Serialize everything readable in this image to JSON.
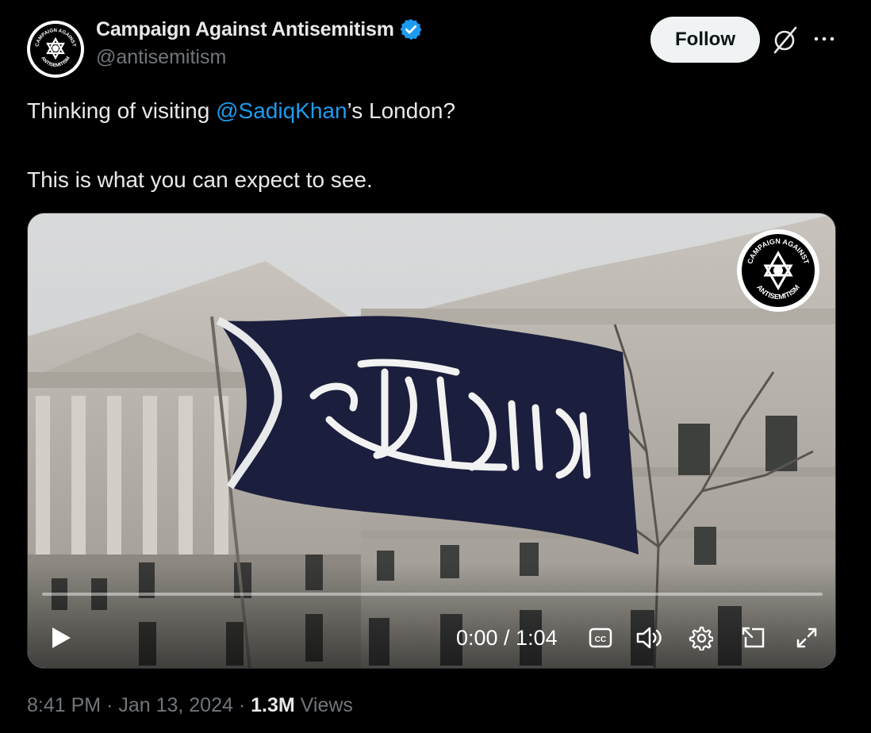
{
  "author": {
    "display_name": "Campaign Against Antisemitism",
    "handle": "@antisemitism",
    "avatar_text_top": "CAMPAIGN AGAINST",
    "avatar_text_bottom": "ANTISEMITISM",
    "verified": true
  },
  "actions": {
    "follow_label": "Follow",
    "grok_icon": "grok-icon",
    "more_icon": "more-icon"
  },
  "tweet": {
    "text_before": "Thinking of visiting ",
    "mention": "@SadiqKhan",
    "text_after": "’s London?",
    "line2": "This is what you can expect to see."
  },
  "video": {
    "watermark_top": "CAMPAIGN AGAINST",
    "watermark_bottom": "ANTISEMITISM",
    "time_display": "0:00 / 1:04",
    "progress": 0,
    "controls": [
      "play-icon",
      "closed-captions-icon",
      "volume-icon",
      "settings-icon",
      "picture-in-picture-icon",
      "fullscreen-icon"
    ]
  },
  "meta": {
    "time": "8:41 PM",
    "separator": " · ",
    "date": "Jan 13, 2024",
    "views_count": "1.3M",
    "views_label": " Views"
  },
  "colors": {
    "background": "#000000",
    "accent": "#1d9bf0",
    "muted": "#71767b",
    "text": "#e7e9ea"
  }
}
